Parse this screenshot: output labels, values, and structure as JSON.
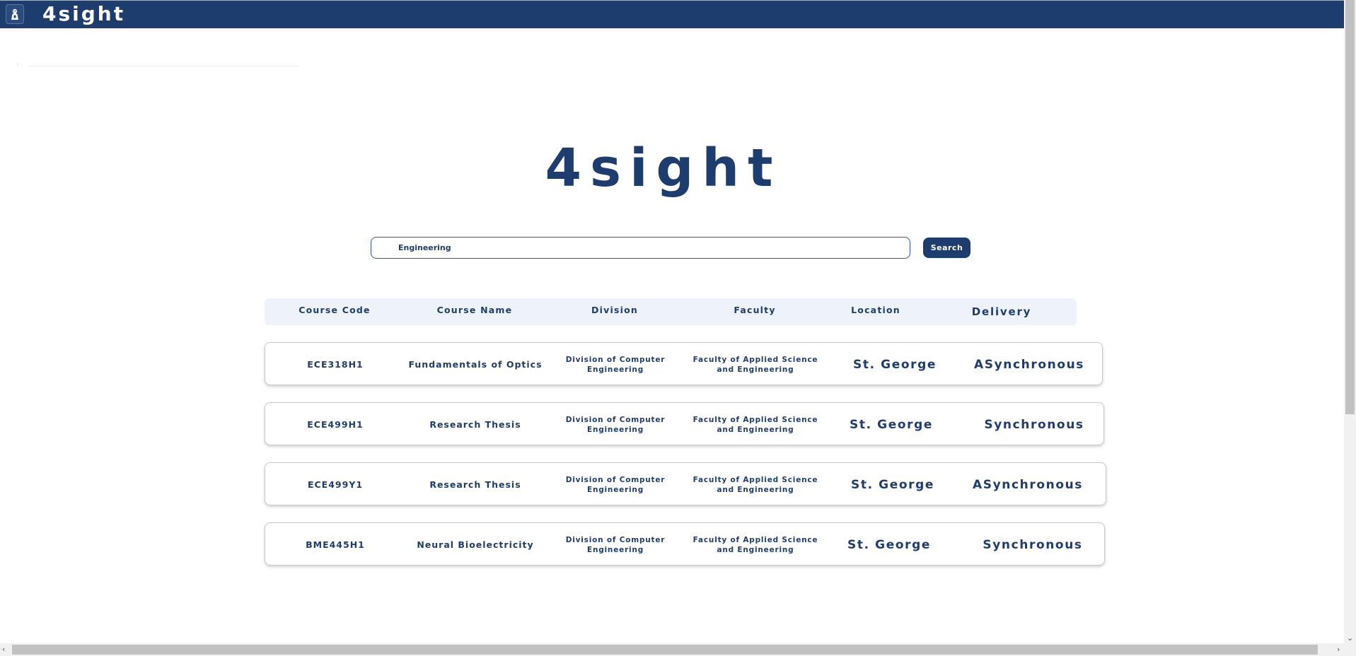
{
  "navbar": {
    "brand": "4sight"
  },
  "hero": {
    "title": "4sight"
  },
  "search": {
    "value": "Engineering",
    "button_label": "Search"
  },
  "table": {
    "headers": [
      "Course Code",
      "Course Name",
      "Division",
      "Faculty",
      "Location",
      "Delivery"
    ],
    "rows": [
      {
        "code": "ECE318H1",
        "name": "Fundamentals of Optics",
        "division": "Division of Computer Engineering",
        "faculty": "Faculty of Applied Science and Engineering",
        "location": "St. George",
        "delivery": "ASynchronous"
      },
      {
        "code": "ECE499H1",
        "name": "Research Thesis",
        "division": "Division of Computer Engineering",
        "faculty": "Faculty of Applied Science and Engineering",
        "location": "St. George",
        "delivery": "Synchronous"
      },
      {
        "code": "ECE499Y1",
        "name": "Research Thesis",
        "division": "Division of Computer Engineering",
        "faculty": "Faculty of Applied Science and Engineering",
        "location": "St. George",
        "delivery": "ASynchronous"
      },
      {
        "code": "BME445H1",
        "name": "Neural Bioelectricity",
        "division": "Division of Computer Engineering",
        "faculty": "Faculty of Applied Science and Engineering",
        "location": "St. George",
        "delivery": "Synchronous"
      }
    ]
  },
  "icons": {
    "logo": "owl-logo-icon",
    "scroll_up": "scroll-up-arrow-icon",
    "scroll_down": "scroll-down-arrow-icon",
    "scroll_left": "scroll-left-arrow-icon",
    "scroll_right": "scroll-right-arrow-icon"
  },
  "colors": {
    "primary": "#1e3d6f",
    "header_bg": "#eef3fb",
    "input_border": "#2a5ab0"
  }
}
